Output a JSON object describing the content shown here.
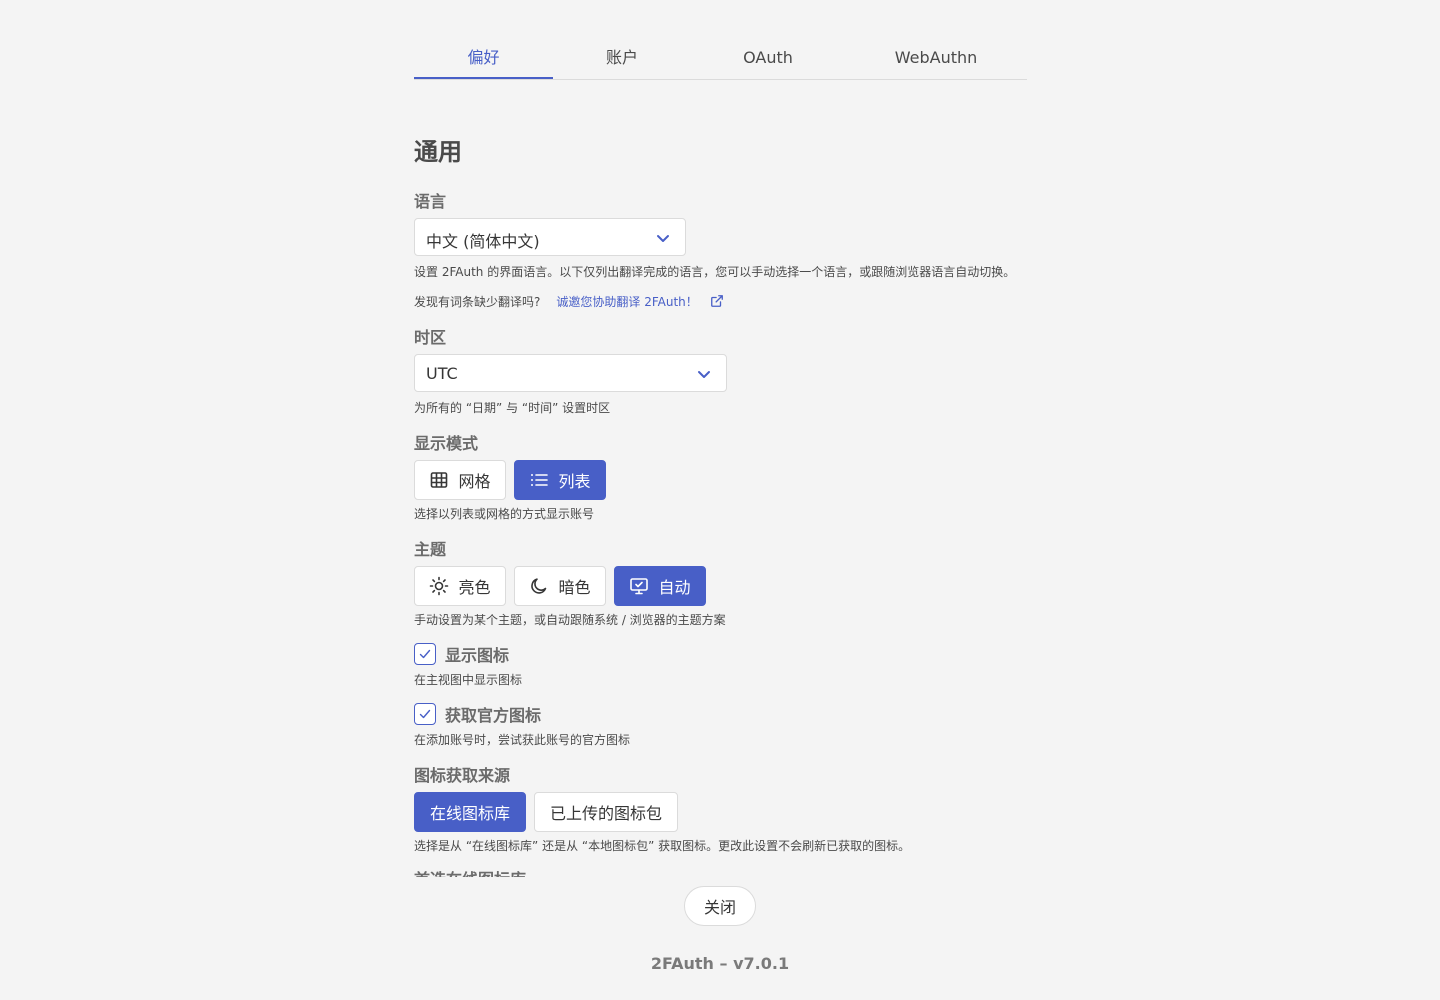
{
  "tabs": [
    {
      "label": "偏好",
      "active": true
    },
    {
      "label": "账户",
      "active": false
    },
    {
      "label": "OAuth",
      "active": false
    },
    {
      "label": "WebAuthn",
      "active": false
    }
  ],
  "general": {
    "title": "通用",
    "language": {
      "label": "语言",
      "value": "中文 (简体中文)",
      "help": "设置 2FAuth 的界面语言。以下仅列出翻译完成的语言，您可以手动选择一个语言，或跟随浏览器语言自动切换。",
      "missing_text": "发现有词条缺少翻译吗?",
      "missing_link": "诚邀您协助翻译 2FAuth！"
    },
    "timezone": {
      "label": "时区",
      "value": "UTC",
      "help": "为所有的 “日期” 与 “时间” 设置时区"
    },
    "display_mode": {
      "label": "显示模式",
      "options": [
        {
          "label": "网格",
          "icon": "grid-icon",
          "selected": false
        },
        {
          "label": "列表",
          "icon": "list-icon",
          "selected": true
        }
      ],
      "help": "选择以列表或网格的方式显示账号"
    },
    "theme": {
      "label": "主题",
      "options": [
        {
          "label": "亮色",
          "icon": "sun-icon",
          "selected": false
        },
        {
          "label": "暗色",
          "icon": "moon-icon",
          "selected": false
        },
        {
          "label": "自动",
          "icon": "monitor-icon",
          "selected": true
        }
      ],
      "help": "手动设置为某个主题，或自动跟随系统 / 浏览器的主题方案"
    },
    "show_icons": {
      "label": "显示图标",
      "checked": true,
      "help": "在主视图中显示图标"
    },
    "fetch_official_icons": {
      "label": "获取官方图标",
      "checked": true,
      "help": "在添加账号时，尝试获此账号的官方图标"
    },
    "icon_source": {
      "label": "图标获取来源",
      "options": [
        {
          "label": "在线图标库",
          "selected": true
        },
        {
          "label": "已上传的图标包",
          "selected": false
        }
      ],
      "help": "选择是从 “在线图标库” 还是从 “本地图标包” 获取图标。更改此设置不会刷新已获取的图标。"
    },
    "next_label_cut": "首选在线图标库"
  },
  "close_label": "关闭",
  "footer": "2FAuth – v7.0.1",
  "colors": {
    "accent": "#485fc7",
    "background": "#f4f4f4"
  }
}
